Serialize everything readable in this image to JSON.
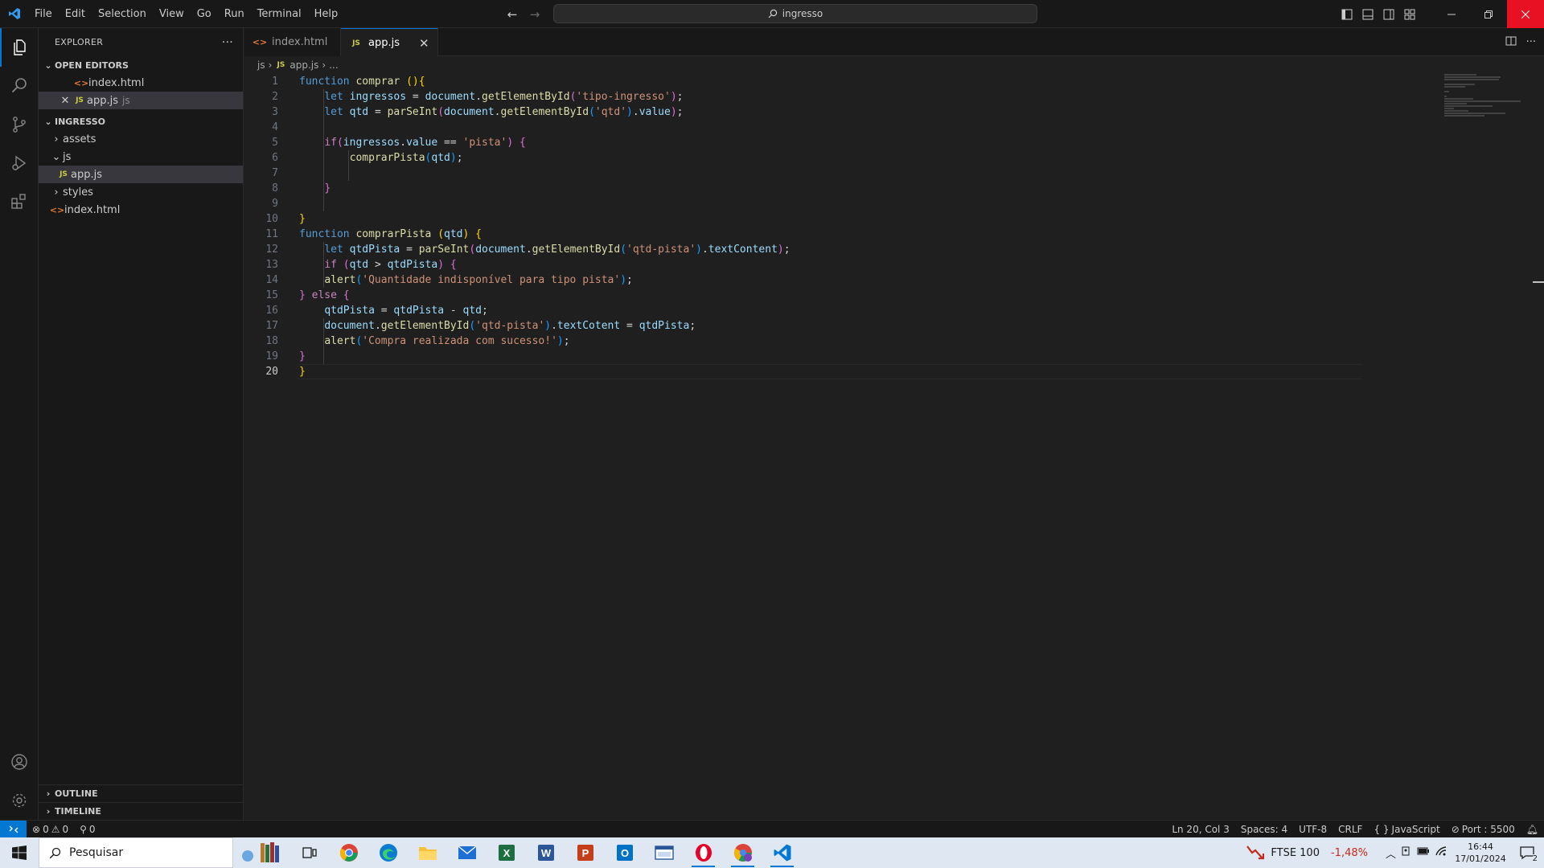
{
  "titlebar": {
    "menu": [
      "File",
      "Edit",
      "Selection",
      "View",
      "Go",
      "Run",
      "Terminal",
      "Help"
    ],
    "search": "ingresso"
  },
  "sidebar": {
    "title": "EXPLORER",
    "open_editors_label": "OPEN EDITORS",
    "open_editors": [
      {
        "name": "index.html",
        "type": "html"
      },
      {
        "name": "app.js",
        "type": "js",
        "hint": "js"
      }
    ],
    "project_label": "INGRESSO",
    "tree": {
      "assets": "assets",
      "js": "js",
      "appjs": "app.js",
      "styles": "styles",
      "index": "index.html"
    },
    "outline_label": "OUTLINE",
    "timeline_label": "TIMELINE"
  },
  "tabs": [
    {
      "label": "index.html",
      "type": "html"
    },
    {
      "label": "app.js",
      "type": "js"
    }
  ],
  "breadcrumb": [
    "js",
    "app.js",
    "..."
  ],
  "code_lines": [
    "function comprar (){",
    "    let ingressos = document.getElementById('tipo-ingresso');",
    "    let qtd = parSeInt(document.getElementById('qtd').value);",
    "",
    "    if(ingressos.value == 'pista') {",
    "        comprarPista(qtd);",
    "",
    "    }",
    "",
    "}",
    "function comprarPista (qtd) {",
    "    let qtdPista = parSeInt(document.getElementById('qtd-pista').textContent);",
    "    if (qtd > qtdPista) {",
    "    alert('Quantidade indisponível para tipo pista');",
    "} else {",
    "    qtdPista = qtdPista - qtd;",
    "    document.getElementById('qtd-pista').textCotent = qtdPista;",
    "    alert('Compra realizada com sucesso!');",
    "}",
    "}"
  ],
  "current_line": 20,
  "statusbar": {
    "errors": "0",
    "warnings": "0",
    "ports": "0",
    "position": "Ln 20, Col 3",
    "spaces": "Spaces: 4",
    "encoding": "UTF-8",
    "eol": "CRLF",
    "language": "JavaScript",
    "port": "Port : 5500"
  },
  "taskbar": {
    "search_placeholder": "Pesquisar",
    "stock_name": "FTSE 100",
    "stock_change": "-1,48%",
    "time": "16:44",
    "date": "17/01/2024",
    "notifications": "2"
  },
  "colors": {
    "accent": "#0078d4",
    "close_button": "#e81123",
    "stock_negative": "#c42b1c"
  }
}
